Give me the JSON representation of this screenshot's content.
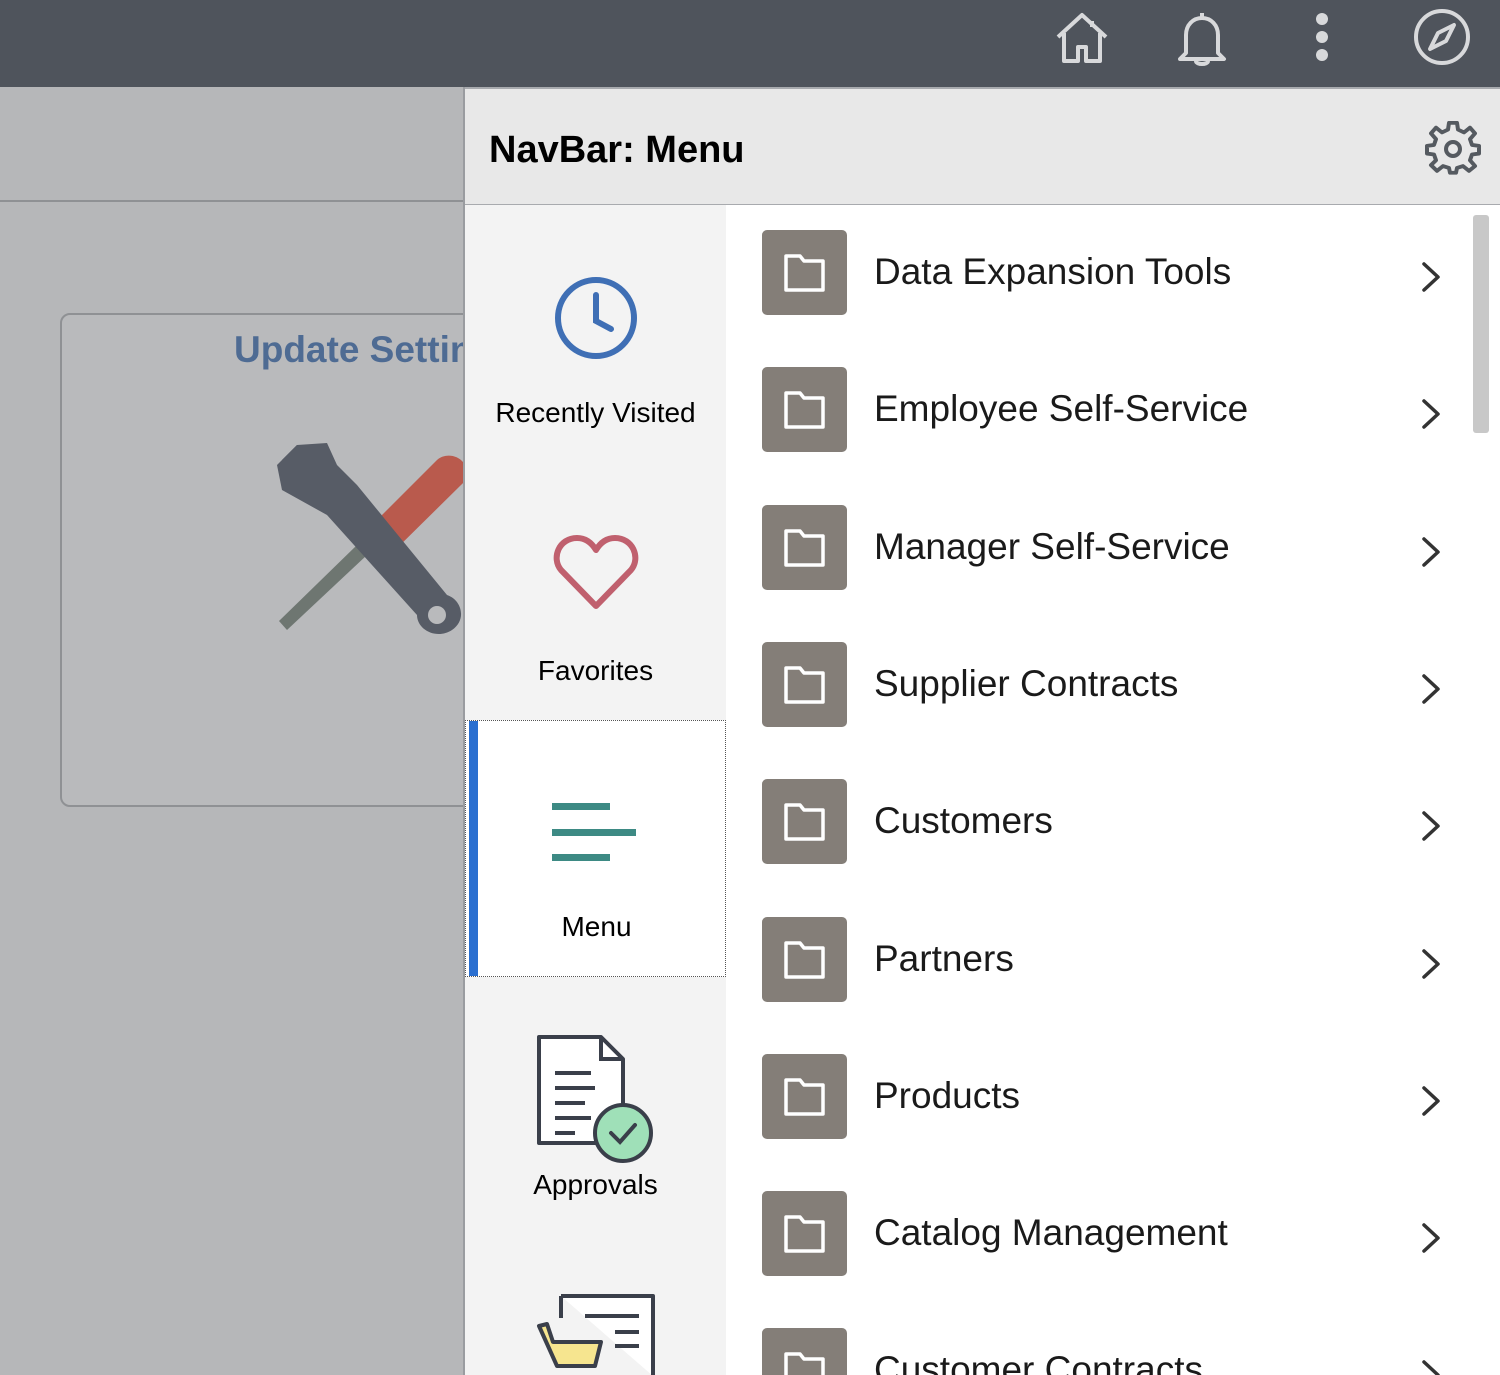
{
  "topbar": {
    "icons": [
      "home-icon",
      "bell-icon",
      "more-vertical-icon",
      "navbar-compass-icon"
    ]
  },
  "background_page": {
    "tile_title": "Update Settin"
  },
  "navbar": {
    "title": "NavBar: Menu",
    "side_items": [
      {
        "label": "Recently Visited",
        "icon": "clock-icon"
      },
      {
        "label": "Favorites",
        "icon": "heart-icon"
      },
      {
        "label": "Menu",
        "icon": "menu-lines-icon",
        "active": true
      },
      {
        "label": "Approvals",
        "icon": "approvals-icon"
      },
      {
        "label": "",
        "icon": "shopping-cart-icon"
      }
    ],
    "menu_items": [
      {
        "label": "Data Expansion Tools"
      },
      {
        "label": "Employee Self-Service"
      },
      {
        "label": "Manager Self-Service"
      },
      {
        "label": "Supplier Contracts"
      },
      {
        "label": "Customers"
      },
      {
        "label": "Partners"
      },
      {
        "label": "Products"
      },
      {
        "label": "Catalog Management"
      },
      {
        "label": "Customer Contracts"
      }
    ]
  },
  "colors": {
    "topbar": "#4f545c",
    "active_accent": "#2a6fd0",
    "folder": "#847e78",
    "clock": "#3f6fb5",
    "heart": "#c0606e",
    "menu_lines": "#3d8a84"
  }
}
